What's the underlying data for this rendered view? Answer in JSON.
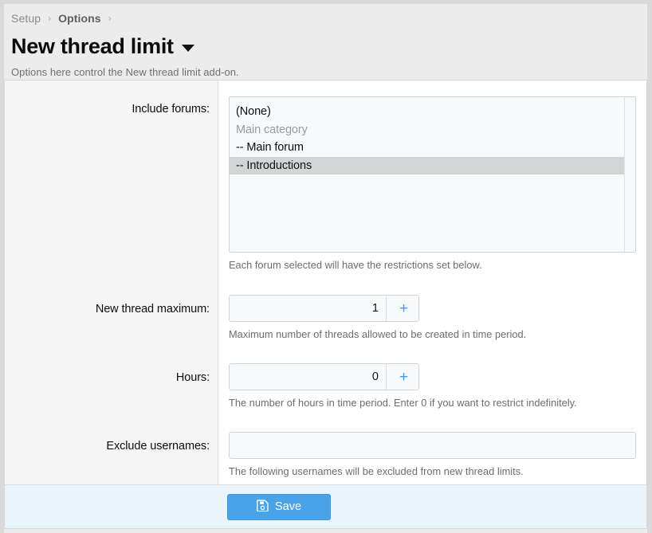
{
  "breadcrumb": {
    "items": [
      {
        "label": "Setup",
        "separator": "›"
      },
      {
        "label": "Options",
        "separator": "›"
      }
    ]
  },
  "header": {
    "title": "New thread limit",
    "caret_icon": "chevron-down-icon",
    "subtitle": "Options here control the New thread limit add-on."
  },
  "form": {
    "rows": [
      {
        "id": "include-forums",
        "label": "Include forums:",
        "hint": "Each forum selected will have the restrictions set below.",
        "options": [
          {
            "label": "(None)",
            "type": "option",
            "selected": false
          },
          {
            "label": "Main category",
            "type": "group",
            "selected": false
          },
          {
            "label": "-- Main forum",
            "type": "option",
            "selected": false
          },
          {
            "label": "-- Introductions",
            "type": "option",
            "selected": true
          }
        ]
      },
      {
        "id": "new-thread-maximum",
        "label": "New thread maximum:",
        "value": "1",
        "increment_label": "+",
        "decrement_label": "−",
        "hint": "Maximum number of threads allowed to be created in time period."
      },
      {
        "id": "hours",
        "label": "Hours:",
        "value": "0",
        "increment_label": "+",
        "decrement_label": "−",
        "hint": "The number of hours in time period. Enter 0 if you want to restrict indefinitely."
      },
      {
        "id": "exclude-usernames",
        "label": "Exclude usernames:",
        "value": "",
        "placeholder": "",
        "hint": "The following usernames will be excluded from new thread limits."
      }
    ]
  },
  "footer": {
    "save_label": "Save",
    "save_icon": "floppy-disk-save-icon"
  },
  "colors": {
    "accent_blue": "#4aa3e8",
    "stepper_glyph_blue": "#3f9bef",
    "footer_background": "#eaf4fc",
    "label_band": "#f5f5f5",
    "input_background": "#f7f9fb",
    "selected_option": "#d4d4d4",
    "page_background": "#ececec"
  }
}
